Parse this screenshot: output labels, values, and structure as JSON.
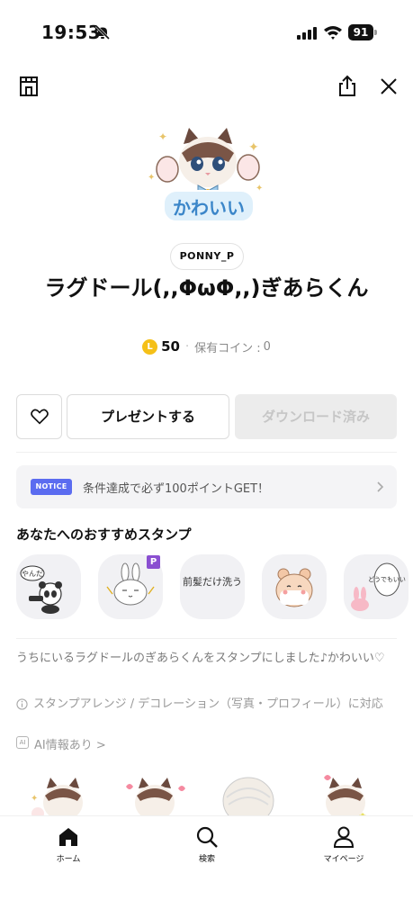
{
  "status_bar": {
    "time": "19:53",
    "battery": "91"
  },
  "header": {
    "shop_icon": "shop-icon",
    "share_icon": "share-icon",
    "close_icon": "close-icon"
  },
  "product": {
    "hero_caption": "かわいい",
    "author": "PONNY_P",
    "title": "ラグドール(,,ΦωΦ,,)ぎあらくん",
    "coin_symbol": "L",
    "price": "50",
    "separator": "·",
    "held_label": "保有コイン :",
    "held_value": "0"
  },
  "actions": {
    "present_label": "プレゼントする",
    "download_label": "ダウンロード済み"
  },
  "notice": {
    "badge": "NOTICE",
    "text": "条件達成で必ず100ポイントGET！"
  },
  "recommend": {
    "title": "あなたへのおすすめスタンプ",
    "premium_badge": "P",
    "items": [
      {
        "caption": "やんだ"
      },
      {
        "caption": ""
      },
      {
        "caption": "前髪だけ洗う"
      },
      {
        "caption": ""
      },
      {
        "caption": "どうでもいい"
      }
    ]
  },
  "description": "うちにいるラグドールのぎあらくんをスタンプにしました♪かわいい♡",
  "features": {
    "arrange": "スタンプアレンジ / デコレーション（写真・プロフィール）に対応",
    "ai_icon": "AI",
    "ai": "AI情報あり >"
  },
  "bottom_nav": {
    "home": "ホーム",
    "search": "検索",
    "mypage": "マイページ"
  },
  "colors": {
    "notice_badge": "#5b6cf0",
    "coin": "#f5c018",
    "premium": "#8a4fd1",
    "disabled_bg": "#ececec"
  }
}
